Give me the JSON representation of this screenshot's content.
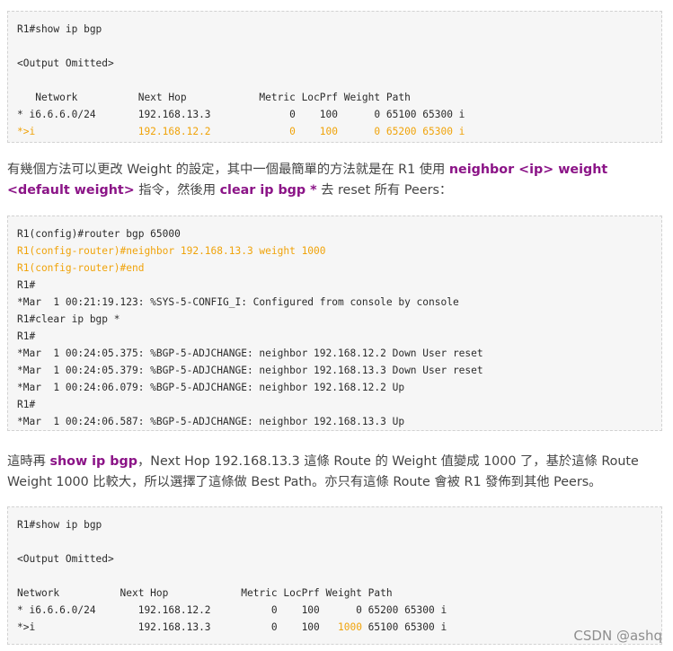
{
  "code1": {
    "lines": [
      "R1#show ip bgp",
      "",
      "<Output Omitted>",
      "",
      "   Network          Next Hop            Metric LocPrf Weight Path",
      "* i6.6.6.0/24       192.168.13.3             0    100      0 65100 65300 i",
      "*>i                 192.168.12.2             0    100      0 65200 65300 i"
    ]
  },
  "para1": {
    "t1": "有幾個方法可以更改 Weight 的設定，其中一個最簡單的方法就是在 R1 使用 ",
    "k1": "neighbor <ip> weight <default weight>",
    "t2": " 指令，然後用 ",
    "k2": "clear ip bgp *",
    "t3": " 去 reset 所有 Peers："
  },
  "code2": {
    "lines": [
      "R1(config)#router bgp 65000",
      "R1(config-router)#neighbor 192.168.13.3 weight 1000",
      "R1(config-router)#end",
      "R1#",
      "*Mar  1 00:21:19.123: %SYS-5-CONFIG_I: Configured from console by console",
      "R1#clear ip bgp *",
      "R1#",
      "*Mar  1 00:24:05.375: %BGP-5-ADJCHANGE: neighbor 192.168.12.2 Down User reset",
      "*Mar  1 00:24:05.379: %BGP-5-ADJCHANGE: neighbor 192.168.13.3 Down User reset",
      "*Mar  1 00:24:06.079: %BGP-5-ADJCHANGE: neighbor 192.168.12.2 Up",
      "R1#",
      "*Mar  1 00:24:06.587: %BGP-5-ADJCHANGE: neighbor 192.168.13.3 Up"
    ]
  },
  "para2": {
    "t1": "這時再 ",
    "k1": "show ip bgp",
    "t2": "，Next Hop 192.168.13.3 這條 Route 的 Weight 值變成 1000 了，基於這條 Route Weight 1000 比較大，所以選擇了這條做 Best Path。亦只有這條 Route 會被 R1 發佈到其他 Peers。"
  },
  "code3": {
    "lines": [
      "R1#show ip bgp",
      "",
      "<Output Omitted>",
      "",
      "Network          Next Hop            Metric LocPrf Weight Path",
      "* i6.6.6.0/24       192.168.12.2          0    100      0 65200 65300 i"
    ],
    "last_line_a": "*>i                 192.168.13.3          0    100   ",
    "last_line_weight": "1000",
    "last_line_b": " 65100 65300 i"
  },
  "watermark": "CSDN @ashq",
  "colors": {
    "highlight": "#f0a30a",
    "keyword": "#8b1487",
    "code_bg": "#f6f6f6"
  }
}
